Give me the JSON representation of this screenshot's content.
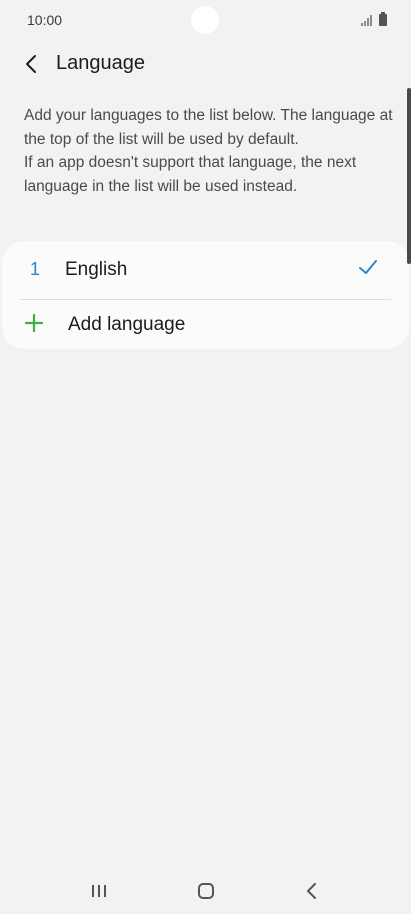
{
  "status_bar": {
    "time": "10:00",
    "icons": [
      "signal-icon",
      "battery-icon"
    ]
  },
  "header": {
    "back_icon": "chevron-left-icon",
    "title": "Language"
  },
  "description": {
    "line1": "Add your languages to the list below. The language at the top of the list will be used by default.",
    "line2": "If an app doesn't support that language, the next language in the list will be used instead."
  },
  "languages": [
    {
      "rank": "1",
      "name": "English",
      "selected": true
    }
  ],
  "add_language": {
    "label": "Add language",
    "icon": "plus-icon"
  },
  "colors": {
    "accent": "#2a87c7",
    "add_green": "#3cb043",
    "background": "#f2f2f2",
    "card": "#fbfbfb"
  },
  "nav_bar": {
    "icons": [
      "recents-icon",
      "home-icon",
      "back-icon"
    ]
  }
}
